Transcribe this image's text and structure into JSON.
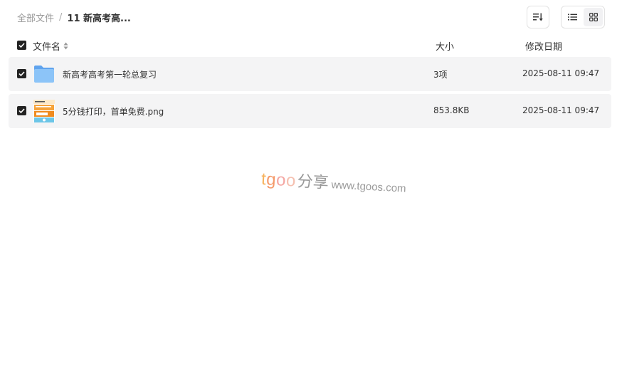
{
  "breadcrumb": {
    "root": "全部文件",
    "separator": "/",
    "current": "11 新高考高..."
  },
  "toolbar": {
    "sort_icon": "sort-icon",
    "list_view_icon": "list-view-icon",
    "grid_view_icon": "grid-view-icon",
    "active_view": "list"
  },
  "header": {
    "select_all_checked": true,
    "name": "文件名",
    "size": "大小",
    "date": "修改日期"
  },
  "files": [
    {
      "checked": true,
      "icon": "folder-icon",
      "name": "新高考高考第一轮总复习",
      "size": "3项",
      "date": "2025-08-11 09:47"
    },
    {
      "checked": true,
      "icon": "image-thumbnail",
      "name": "5分钱打印，首单免费.png",
      "size": "853.8KB",
      "date": "2025-08-11 09:47"
    }
  ],
  "watermark": {
    "brand": "tgoo",
    "cn": "分享",
    "url": "www.tgoos.com"
  },
  "colors": {
    "row_background": "#f4f4f5",
    "checkbox": "#222222",
    "folder": "#7db8f5",
    "muted_text": "#999999"
  }
}
